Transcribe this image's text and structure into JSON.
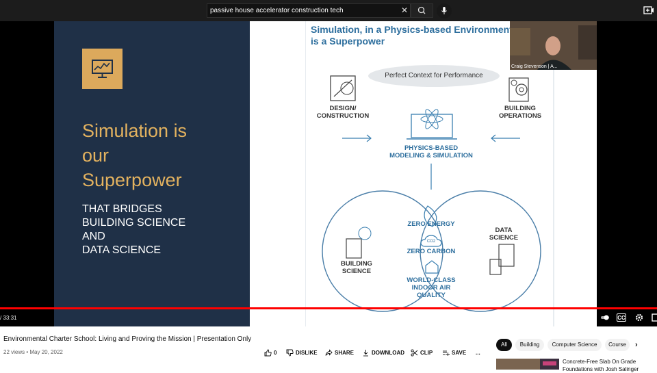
{
  "search": {
    "query": "passive house accelerator construction tech"
  },
  "slide": {
    "heading_lines": [
      "Simulation is",
      "our",
      "Superpower"
    ],
    "sub_lines": [
      "THAT BRIDGES",
      "BUILDING SCIENCE",
      "AND",
      "DATA SCIENCE"
    ],
    "right_title": "Simulation, in a Physics-based Environment\nis a Superpower",
    "context_pill": "Perfect Context for Performance",
    "design_label": "DESIGN/\nCONSTRUCTION",
    "operations_label": "BUILDING\nOPERATIONS",
    "physics_label": "PHYSICS-BASED\nMODELING & SIMULATION",
    "zero_energy": "ZERO ENERGY",
    "zero_carbon": "ZERO CARBON",
    "world_class": "WORLD-CLASS\nINDOOR AIR\nQUALITY",
    "building_science": "BUILDING\nSCIENCE",
    "data_science": "DATA\nSCIENCE",
    "co2": "CO2"
  },
  "webcam": {
    "name": "Craig Stevenson | A..."
  },
  "player": {
    "time": "/ 33:31",
    "progress": 1.0
  },
  "video": {
    "title": "Environmental Charter School: Living and Proving the Mission | Presentation Only",
    "meta": "22 views • May 20, 2022"
  },
  "actions": {
    "likes": "0",
    "dislike": "DISLIKE",
    "share": "SHARE",
    "download": "DOWNLOAD",
    "clip": "CLIP",
    "save": "SAVE",
    "more": "..."
  },
  "chips": [
    "All",
    "Building",
    "Computer Science",
    "Course"
  ],
  "recommended": {
    "title": "Concrete-Free Slab On Grade Foundations with Josh Salinger"
  },
  "colors": {
    "accent_red": "#ff0000",
    "slide_navy": "#1f3047",
    "slide_gold": "#e3b25f",
    "diagram_blue": "#2e6f9e"
  }
}
